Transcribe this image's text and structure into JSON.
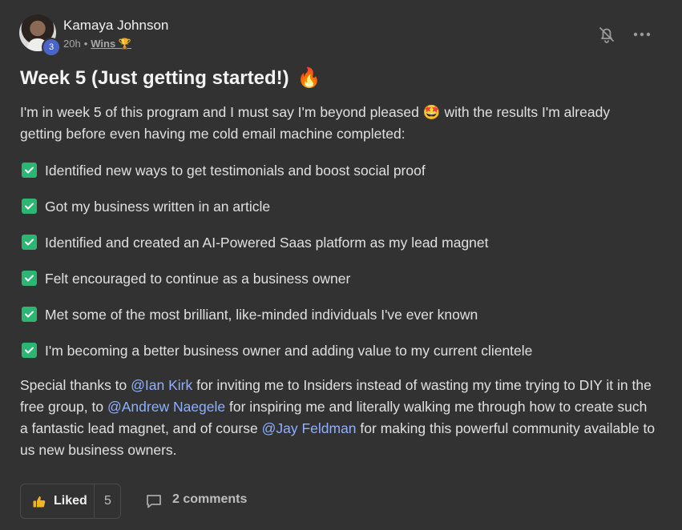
{
  "author": {
    "name": "Kamaya Johnson",
    "level": "3",
    "time": "20h",
    "separator": "•",
    "category": "Wins 🏆"
  },
  "post": {
    "title": "Week 5 (Just getting started!)",
    "title_emoji": "🔥",
    "intro_before": "I'm in week 5 of this program and I must say I'm beyond pleased",
    "intro_emoji": "🤩",
    "intro_after": "with the results I'm already getting before even having me cold email machine completed:",
    "checklist": [
      "Identified new ways to get testimonials and boost social proof",
      "Got my business written in an article",
      "Identified and created an AI-Powered Saas platform as my lead magnet",
      "Felt encouraged to continue as a business owner",
      "Met some of the most brilliant, like-minded individuals I've ever known",
      "I'm becoming a better business owner and adding value to my current clientele"
    ],
    "thanks": {
      "t1": "Special thanks to",
      "m1": "@Ian Kirk",
      "t2": "for inviting me to Insiders instead of wasting my time trying to DIY it in the free group, to",
      "m2": "@Andrew Naegele",
      "t3": "for inspiring me and literally walking me through how to create such a fantastic lead magnet, and of course",
      "m3": "@Jay Feldman",
      "t4": "for making this powerful community available to us new business owners."
    }
  },
  "footer": {
    "like_label": "Liked",
    "like_count": "5",
    "comments_label": "2 comments"
  },
  "colors": {
    "background": "#323232",
    "mention": "#8fb0ff",
    "check": "#2bb673",
    "badge": "#4a64c8"
  }
}
